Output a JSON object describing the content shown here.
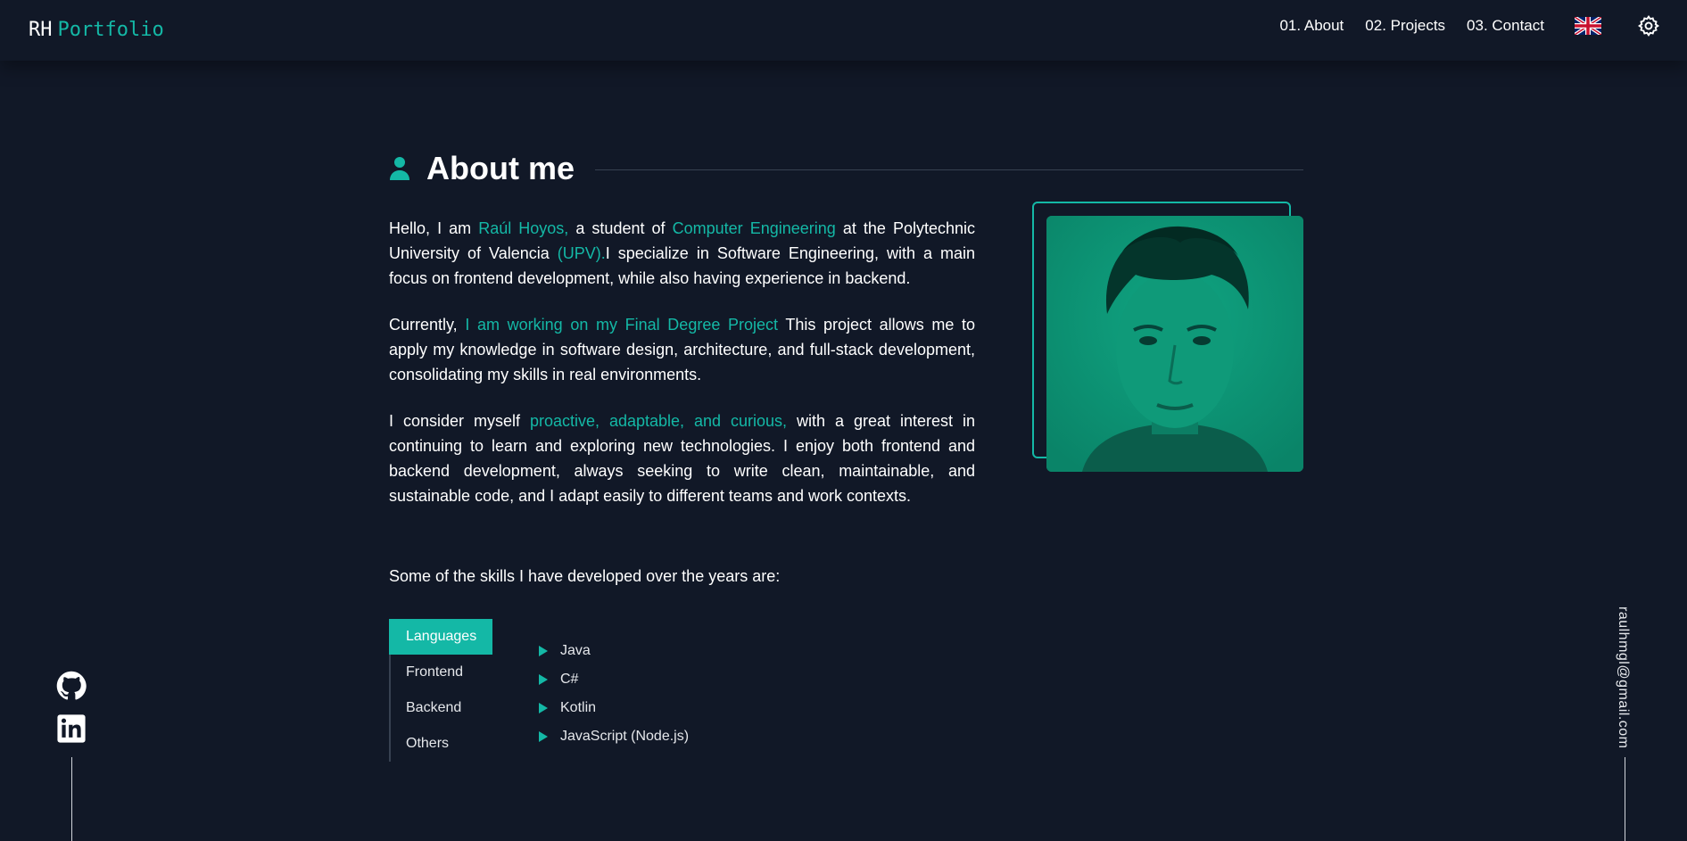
{
  "header": {
    "brand_initials": "RH",
    "brand_name": "Portfolio",
    "nav": [
      {
        "label": "01. About"
      },
      {
        "label": "02. Projects"
      },
      {
        "label": "03. Contact"
      }
    ],
    "language_icon": "uk-flag-icon",
    "settings_icon": "gear-icon"
  },
  "about": {
    "title": "About me",
    "title_icon": "user-icon",
    "p1": {
      "t1": "Hello, I am ",
      "h1": "Raúl Hoyos,",
      "t2": " a student of ",
      "h2": "Computer Engineering",
      "t3": " at the Polytechnic University of Valencia ",
      "h3": "(UPV).",
      "t4": "I specialize in Software Engineering, with a main focus on frontend development, while also having experience in backend."
    },
    "p2": {
      "t1": "Currently, ",
      "h1": "I am working on my Final Degree Project",
      "t2": " This project allows me to apply my knowledge in software design, architecture, and full-stack development, consolidating my skills in real environments."
    },
    "p3": {
      "t1": "I consider myself ",
      "h1": "proactive, adaptable, and curious,",
      "t2": " with a great interest in continuing to learn and exploring new technologies. I enjoy both frontend and backend development, always seeking to write clean, maintainable, and sustainable code, and I adapt easily to different teams and work contexts."
    }
  },
  "skills": {
    "intro": "Some of the skills I have developed over the years are:",
    "tabs": [
      {
        "label": "Languages",
        "active": true
      },
      {
        "label": "Frontend",
        "active": false
      },
      {
        "label": "Backend",
        "active": false
      },
      {
        "label": "Others",
        "active": false
      }
    ],
    "items": [
      "Java",
      "C#",
      "Kotlin",
      "JavaScript (Node.js)"
    ]
  },
  "sidebar": {
    "github_icon": "github-icon",
    "linkedin_icon": "linkedin-icon",
    "email": "raulhmgl@gmail.com"
  },
  "colors": {
    "background": "#111827",
    "accent": "#14b8a6",
    "text": "#ffffff"
  }
}
